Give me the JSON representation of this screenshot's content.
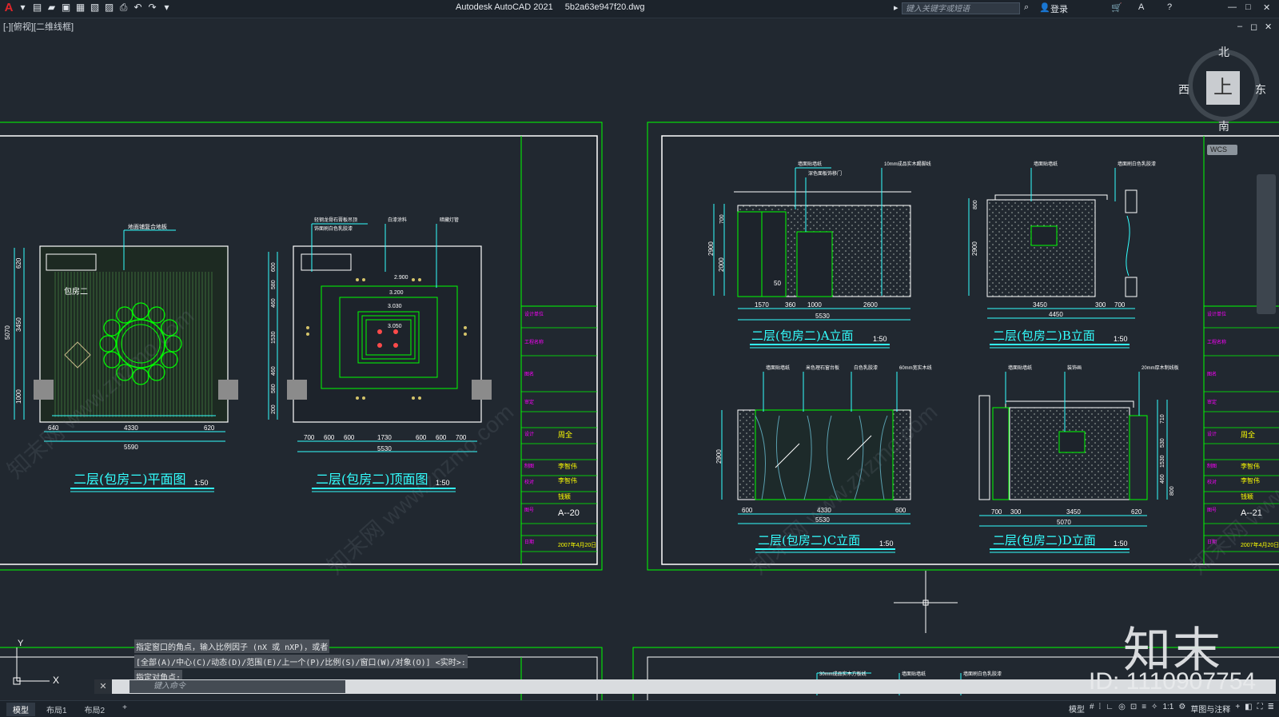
{
  "app": {
    "title": "Autodesk AutoCAD 2021",
    "file": "5b2a63e947f20.dwg",
    "search_placeholder": "键入关键字或短语",
    "login": "登录",
    "view_label": "[-][俯视][二维线框]"
  },
  "viewcube": {
    "north": "北",
    "south": "南",
    "east": "东",
    "west": "西",
    "face": "上",
    "wcs": "WCS"
  },
  "colors": {
    "background": "#212830",
    "cyan": "#33ffff",
    "green": "#00ff00",
    "magenta": "#ff00ff",
    "yellow": "#ffff00",
    "white": "#ffffff"
  },
  "sheet1": {
    "plan": {
      "room": "包房二",
      "title": "二层(包房二)平面图",
      "scale": "1:50",
      "note": "地面铺复合地板",
      "dims_bottom": [
        "640",
        "4330",
        "620"
      ],
      "dims_total": "5590",
      "dims_left": [
        "620",
        "3450",
        "1000"
      ],
      "dims_left_total": "5070"
    },
    "ceiling": {
      "title": "二层(包房二)顶面图",
      "scale": "1:50",
      "notes": [
        "轻钢龙骨石膏板吊顶",
        "饰面刷白色乳胶漆",
        "白漆涂料",
        "暗藏灯管"
      ],
      "levels": [
        "2.900",
        "3.200",
        "3.030",
        "3.050"
      ],
      "dims_bottom": [
        "700",
        "600",
        "600",
        "1730",
        "600",
        "600",
        "700"
      ],
      "dims_total": "5530",
      "dims_left": [
        "600",
        "580",
        "460",
        "1530",
        "460",
        "580",
        "200"
      ]
    },
    "titleblock": {
      "designer": "周全",
      "drawer": "李智伟",
      "checker": "李智伟",
      "approver": "钱颖",
      "number": "A--20",
      "date": "2007年4月20日"
    }
  },
  "sheet2": {
    "elev_a": {
      "title": "二层(包房二)A立面",
      "scale": "1:50",
      "notes": [
        "墙面贴墙纸",
        "深色面板饰移门",
        "10mm成品实木踢脚线"
      ],
      "dims_bottom": [
        "1570",
        "360",
        "1000",
        "2600"
      ],
      "dims_total": "5530",
      "dims_left": [
        "2900",
        "2000",
        "700"
      ],
      "door_label": "50"
    },
    "elev_b": {
      "title": "二层(包房二)B立面",
      "scale": "1:50",
      "notes": [
        "墙面贴墙纸",
        "墙面刷白色乳胶漆"
      ],
      "dims_bottom": [
        "3450",
        "300",
        "700"
      ],
      "dims_total": "4450",
      "dims_left": [
        "2900",
        "800"
      ]
    },
    "elev_c": {
      "title": "二层(包房二)C立面",
      "scale": "1:50",
      "notes": [
        "墙面贴墙纸",
        "米色理石窗台板",
        "白色乳胶漆",
        "60mm宽实木线"
      ],
      "dims_bottom": [
        "600",
        "4330",
        "600"
      ],
      "dims_total": "5530",
      "dims_left": [
        "2900"
      ]
    },
    "elev_d": {
      "title": "二层(包房二)D立面",
      "scale": "1:50",
      "notes": [
        "墙面贴墙纸",
        "装饰画",
        "20mm厚木制线板"
      ],
      "dims_bottom": [
        "700",
        "300",
        "3450",
        "620"
      ],
      "dims_total": "5070",
      "dims_right": [
        "710",
        "530",
        "1530",
        "460",
        "800"
      ]
    },
    "titleblock": {
      "designer": "周全",
      "drawer": "李智伟",
      "checker": "李智伟",
      "approver": "钱颖",
      "number": "A--21",
      "date": "2007年4月20日"
    }
  },
  "sheet3": {
    "notes": [
      "30mm成品实木方板线",
      "墙面贴墙纸",
      "墙面刷白色乳胶漆"
    ]
  },
  "command": {
    "history": [
      "指定窗口的角点，输入比例因子 (nX 或 nXP)，或者",
      "[全部(A)/中心(C)/动态(D)/范围(E)/上一个(P)/比例(S)/窗口(W)/对象(O)] <实时>:",
      "指定对角点:"
    ],
    "placeholder": "键入命令"
  },
  "tabs": [
    "模型",
    "布局1",
    "布局2"
  ],
  "status": {
    "model": "模型",
    "scale": "1:1",
    "workspace": "草图与注释"
  },
  "watermark": {
    "brand": "知末",
    "id": "ID: 1110907754",
    "site": "知末网 www.znzmo.com"
  }
}
